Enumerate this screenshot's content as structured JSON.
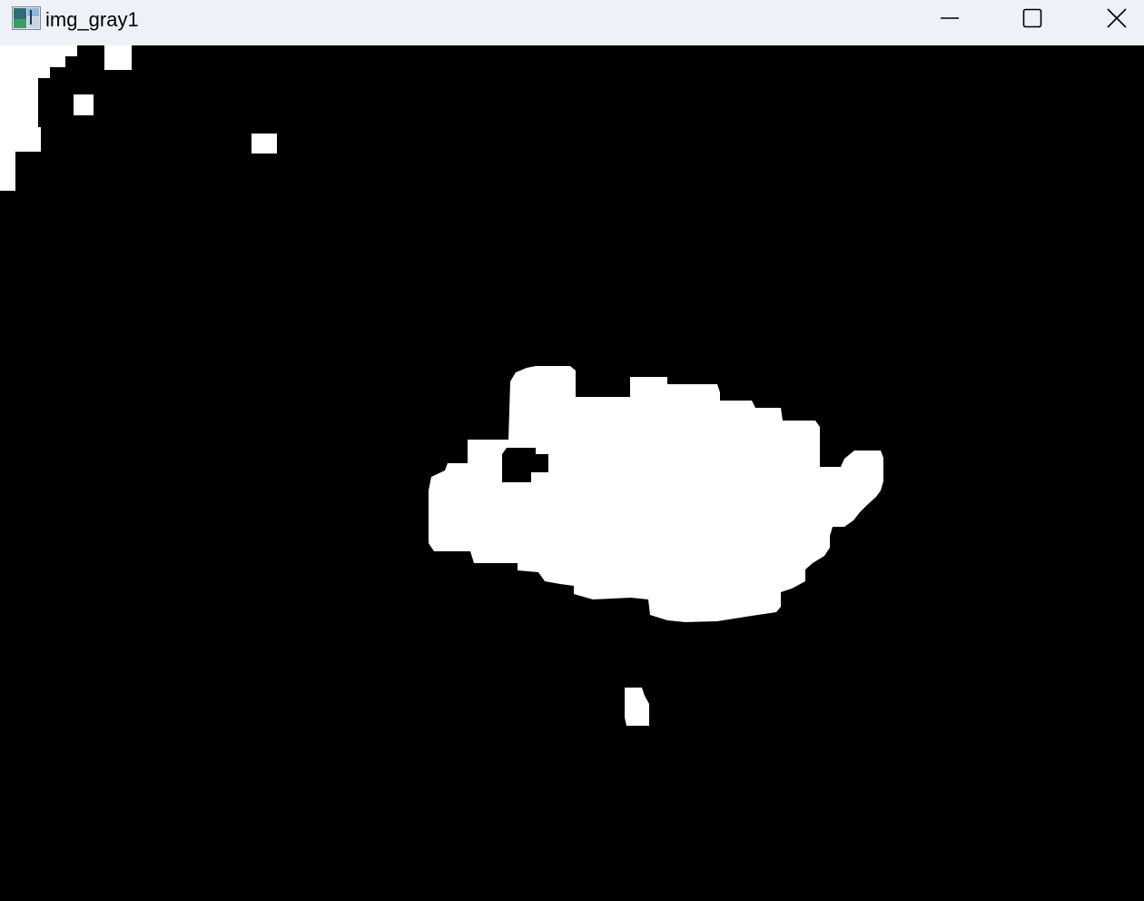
{
  "window": {
    "title": "img_gray1",
    "controls": {
      "minimize": "minimize-icon",
      "maximize": "maximize-icon",
      "close": "close-icon"
    }
  },
  "image": {
    "kind": "binary thresholded grayscale image",
    "background_color": "#000000",
    "foreground_color": "#ffffff"
  },
  "colors": {
    "titlebar_bg": "#eef2f8",
    "title_text": "#000000"
  }
}
